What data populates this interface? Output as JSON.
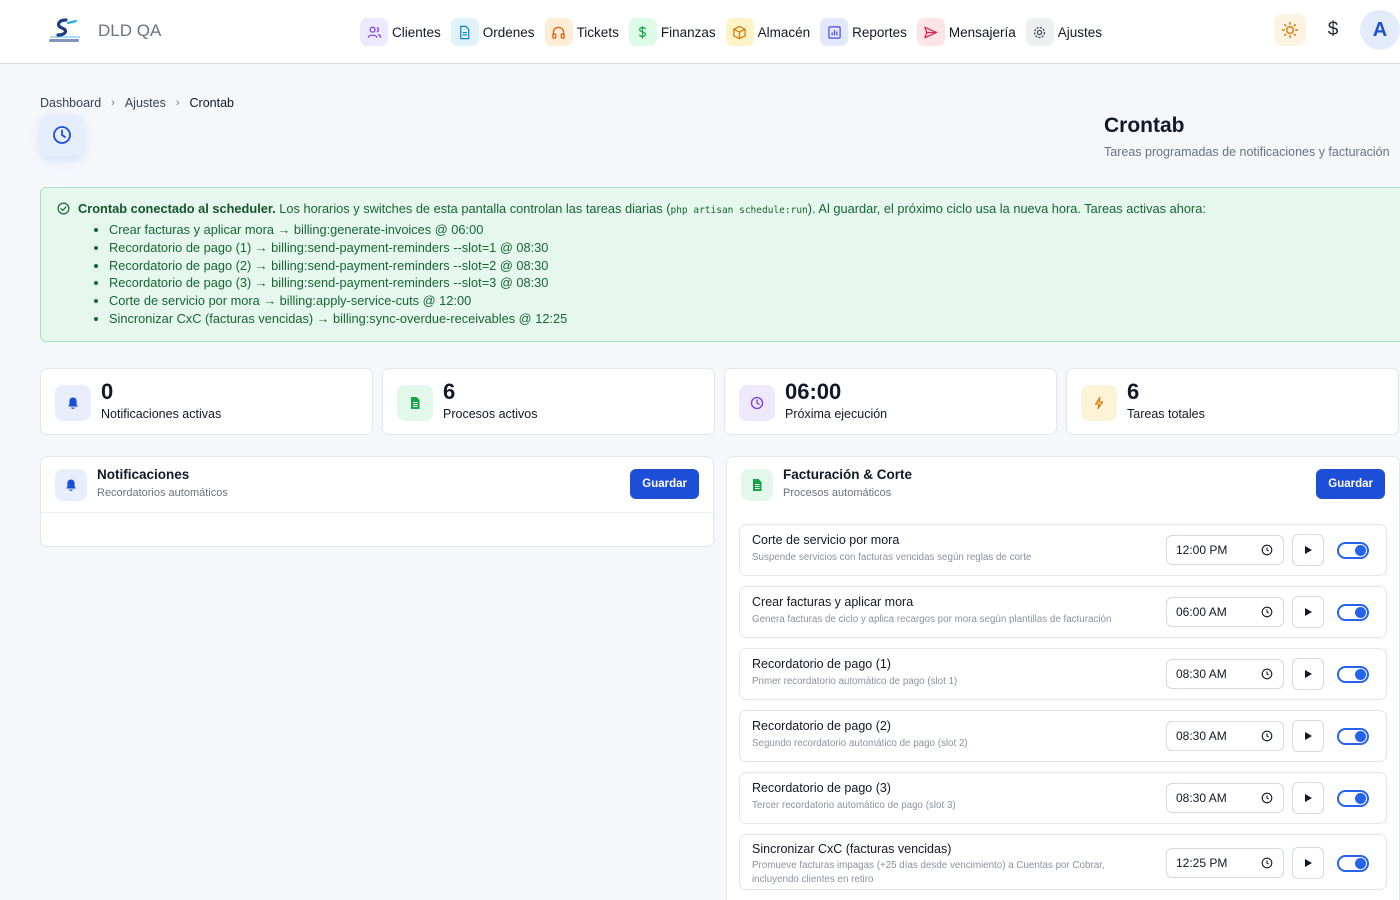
{
  "app": {
    "name": "DLD QA",
    "logo_text": "SKYPLINK"
  },
  "nav": [
    {
      "label": "Clientes",
      "icon": "users-icon",
      "tint": "#ede9fe",
      "color": "#7c3aed"
    },
    {
      "label": "Ordenes",
      "icon": "document-icon",
      "tint": "#e0f2fe",
      "color": "#0284c7"
    },
    {
      "label": "Tickets",
      "icon": "headphones-icon",
      "tint": "#ffedd5",
      "color": "#ea580c"
    },
    {
      "label": "Finanzas",
      "icon": "dollar-icon",
      "tint": "#dcfce7",
      "color": "#16a34a"
    },
    {
      "label": "Almacén",
      "icon": "box-icon",
      "tint": "#fef3c7",
      "color": "#d97706"
    },
    {
      "label": "Reportes",
      "icon": "bar-chart-icon",
      "tint": "#e0e7ff",
      "color": "#4f46e5"
    },
    {
      "label": "Mensajería",
      "icon": "send-icon",
      "tint": "#ffe4e6",
      "color": "#e11d48"
    },
    {
      "label": "Ajustes",
      "icon": "gear-icon",
      "tint": "#eef0f4",
      "color": "#374151"
    }
  ],
  "topright": {
    "currency_symbol": "$",
    "avatar_initial": "A"
  },
  "breadcrumb": {
    "items": [
      "Dashboard",
      "Ajustes",
      "Crontab"
    ]
  },
  "header": {
    "title": "Crontab",
    "subtitle": "Tareas programadas de notificaciones y facturación"
  },
  "alert": {
    "strong": "Crontab conectado al scheduler.",
    "text_before": " Los horarios y switches de esta pantalla controlan las tareas diarias (",
    "code": "php artisan schedule:run",
    "text_after": "). Al guardar, el próximo ciclo usa la nueva hora. Tareas activas ahora:",
    "items": [
      "Crear facturas y aplicar mora → billing:generate-invoices @ 06:00",
      "Recordatorio de pago (1) → billing:send-payment-reminders --slot=1 @ 08:30",
      "Recordatorio de pago (2) → billing:send-payment-reminders --slot=2 @ 08:30",
      "Recordatorio de pago (3) → billing:send-payment-reminders --slot=3 @ 08:30",
      "Corte de servicio por mora → billing:apply-service-cuts @ 12:00",
      "Sincronizar CxC (facturas vencidas) → billing:sync-overdue-receivables @ 12:25"
    ]
  },
  "stats": [
    {
      "value": "0",
      "label": "Notificaciones activas",
      "icon": "bell-icon"
    },
    {
      "value": "6",
      "label": "Procesos activos",
      "icon": "file-icon"
    },
    {
      "value": "06:00",
      "label": "Próxima ejecución",
      "icon": "clock-icon"
    },
    {
      "value": "6",
      "label": "Tareas totales",
      "icon": "bolt-icon"
    }
  ],
  "notifications_panel": {
    "title": "Notificaciones",
    "subtitle": "Recordatorios automáticos",
    "save_label": "Guardar"
  },
  "billing_panel": {
    "title": "Facturación & Corte",
    "subtitle": "Procesos automáticos",
    "save_label": "Guardar",
    "tasks": [
      {
        "name": "Corte de servicio por mora",
        "description": "Suspende servicios con facturas vencidas según reglas de corte",
        "time": "12:00 PM",
        "enabled": true
      },
      {
        "name": "Crear facturas y aplicar mora",
        "description": "Genera facturas de ciclo y aplica recargos por mora según plantillas de facturación",
        "time": "06:00 AM",
        "enabled": true
      },
      {
        "name": "Recordatorio de pago (1)",
        "description": "Primer recordatorio automático de pago (slot 1)",
        "time": "08:30 AM",
        "enabled": true
      },
      {
        "name": "Recordatorio de pago (2)",
        "description": "Segundo recordatorio automático de pago (slot 2)",
        "time": "08:30 AM",
        "enabled": true
      },
      {
        "name": "Recordatorio de pago (3)",
        "description": "Tercer recordatorio automático de pago (slot 3)",
        "time": "08:30 AM",
        "enabled": true
      },
      {
        "name": "Sincronizar CxC (facturas vencidas)",
        "description": "Promueve facturas impagas (+25 días desde vencimiento) a Cuentas por Cobrar, incluyendo clientes en retiro",
        "time": "12:25 PM",
        "enabled": true
      }
    ]
  },
  "colors": {
    "primary": "#1d4ed8",
    "success_bg": "#e6f8ee",
    "success_text": "#166534"
  }
}
